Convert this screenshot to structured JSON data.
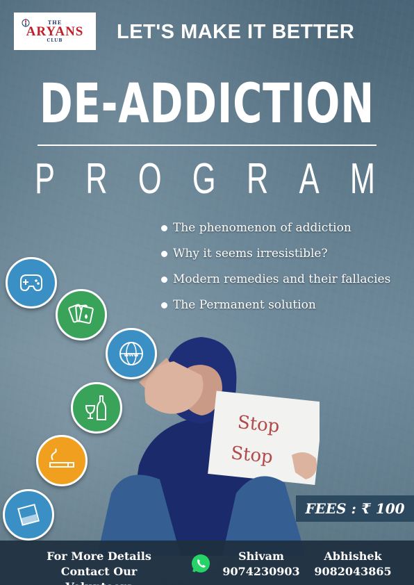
{
  "logo": {
    "the": "THE",
    "name": "ARYANS",
    "club": "CLUB"
  },
  "tagline": "LET'S MAKE IT BETTER",
  "title": "DE-ADDICTION",
  "subtitle": [
    "P",
    "R",
    "O",
    "G",
    "R",
    "A",
    "M"
  ],
  "bullets": [
    "The phenomenon of addiction",
    "Why it seems irresistible?",
    "Modern remedies and their fallacies",
    "The Permanent solution"
  ],
  "icons": [
    {
      "name": "game-controller-icon",
      "color": "#3a8fc4"
    },
    {
      "name": "playing-cards-icon",
      "color": "#3aa35a"
    },
    {
      "name": "www-globe-icon",
      "color": "#3a8fc4"
    },
    {
      "name": "wine-bottle-icon",
      "color": "#3aa35a"
    },
    {
      "name": "cigarette-icon",
      "color": "#f0a01e"
    },
    {
      "name": "drug-bag-icon",
      "color": "#3a8fc4"
    }
  ],
  "sign": {
    "line1": "Stop",
    "line2": "Stop"
  },
  "fees": "FEES : ₹ 100",
  "footer": {
    "details_line1": "For More Details",
    "details_line2": "Contact Our Volunteers",
    "contacts": [
      {
        "name": "Shivam",
        "phone": "9074230903"
      },
      {
        "name": "Abhishek",
        "phone": "9082043865"
      }
    ]
  }
}
